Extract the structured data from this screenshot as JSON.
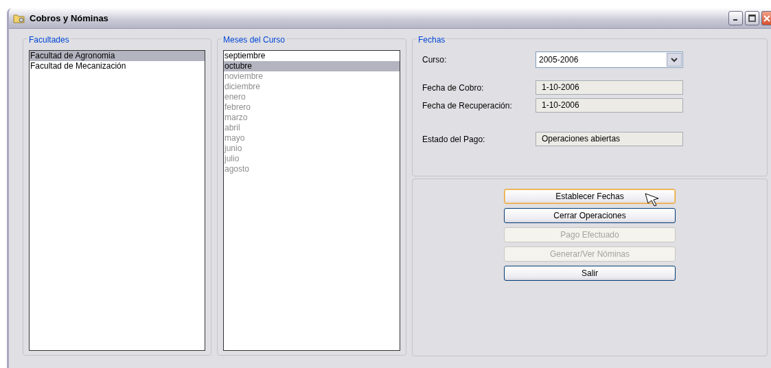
{
  "window": {
    "title": "Cobros y Nóminas"
  },
  "facultades": {
    "title": "Facultades",
    "items": [
      {
        "label": "Facultad de Agronomia",
        "selected": true
      },
      {
        "label": "Facultad de Mecanización",
        "selected": false
      }
    ]
  },
  "meses": {
    "title": "Meses del Curso",
    "items": [
      {
        "label": "septiembre",
        "selected": false,
        "disabled": false
      },
      {
        "label": "octubre",
        "selected": true,
        "disabled": false
      },
      {
        "label": "noviembre",
        "selected": false,
        "disabled": true
      },
      {
        "label": "diciembre",
        "selected": false,
        "disabled": true
      },
      {
        "label": "enero",
        "selected": false,
        "disabled": true
      },
      {
        "label": "febrero",
        "selected": false,
        "disabled": true
      },
      {
        "label": "marzo",
        "selected": false,
        "disabled": true
      },
      {
        "label": "abril",
        "selected": false,
        "disabled": true
      },
      {
        "label": "mayo",
        "selected": false,
        "disabled": true
      },
      {
        "label": "junio",
        "selected": false,
        "disabled": true
      },
      {
        "label": "julio",
        "selected": false,
        "disabled": true
      },
      {
        "label": "agosto",
        "selected": false,
        "disabled": true
      }
    ]
  },
  "fechas": {
    "title": "Fechas",
    "fields": [
      {
        "kind": "dropdown",
        "label": "Curso:",
        "value": "2005-2006"
      },
      {
        "kind": "readonly",
        "label": "Fecha de Cobro:",
        "value": "1-10-2006"
      },
      {
        "kind": "readonly",
        "label": "Fecha de Recuperación:",
        "value": "1-10-2006"
      },
      {
        "kind": "readonly",
        "label": "Estado del Pago:",
        "value": "Operaciones abiertas"
      }
    ]
  },
  "buttons": [
    {
      "label": "Establecer Fechas",
      "disabled": false,
      "focused": true
    },
    {
      "label": "Cerrar Operaciones",
      "disabled": false,
      "focused": false
    },
    {
      "label": "Pago Efectuado",
      "disabled": true,
      "focused": false
    },
    {
      "label": "Generar/Ver Nóminas",
      "disabled": true,
      "focused": false
    },
    {
      "label": "Salir",
      "disabled": false,
      "focused": false
    }
  ]
}
